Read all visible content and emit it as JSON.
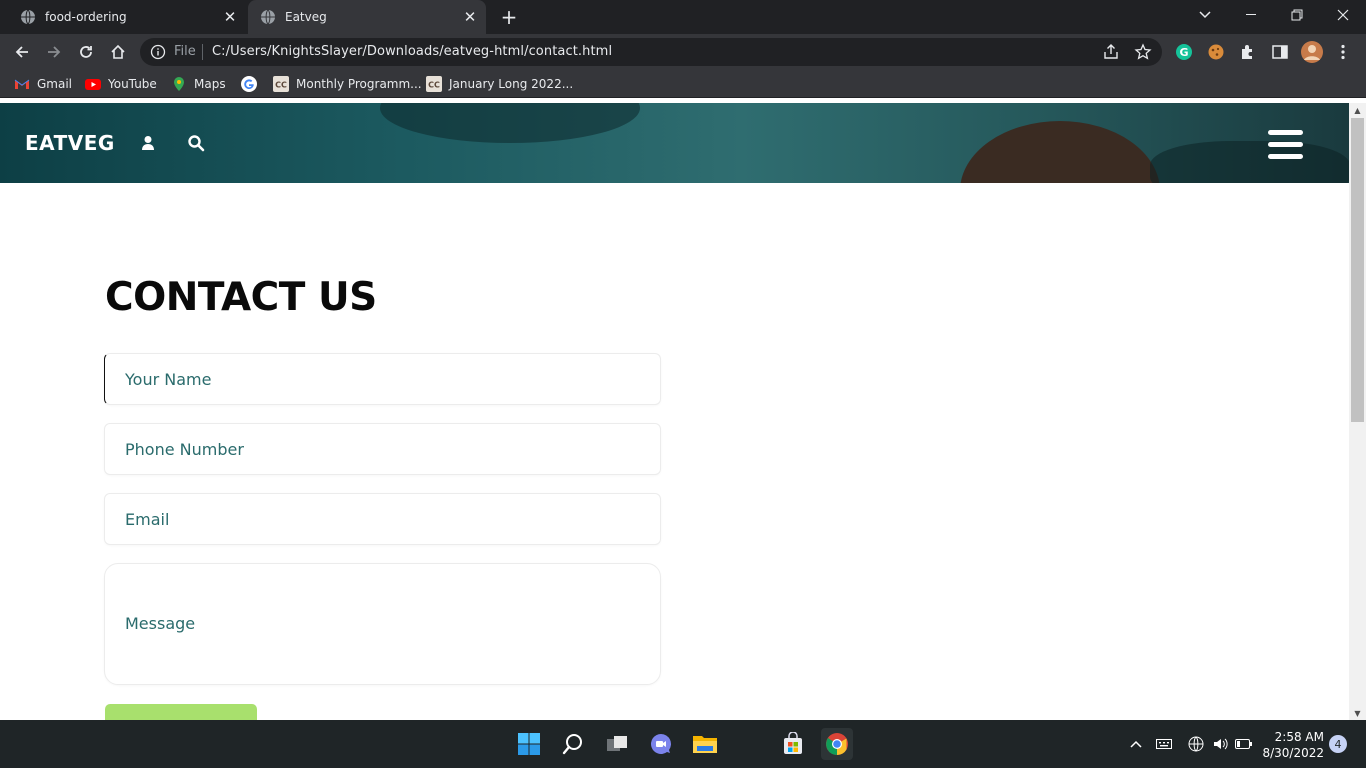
{
  "browser": {
    "tabs": [
      {
        "title": "food-ordering",
        "active": false
      },
      {
        "title": "Eatveg",
        "active": true
      }
    ],
    "address": {
      "scheme_label": "File",
      "url": "C:/Users/KnightsSlayer/Downloads/eatveg-html/contact.html"
    },
    "bookmarks": [
      {
        "label": "Gmail",
        "icon": "gmail-icon"
      },
      {
        "label": "YouTube",
        "icon": "youtube-icon"
      },
      {
        "label": "Maps",
        "icon": "maps-icon"
      },
      {
        "label": "",
        "icon": "google-icon"
      },
      {
        "label": "Monthly Programm...",
        "icon": "codechef-icon"
      },
      {
        "label": "January Long 2022...",
        "icon": "codechef-icon"
      }
    ]
  },
  "site": {
    "brand": "EATVEG",
    "contact": {
      "title": "CONTACT US",
      "name_placeholder": "Your Name",
      "phone_placeholder": "Phone Number",
      "email_placeholder": "Email",
      "message_placeholder": "Message"
    }
  },
  "taskbar": {
    "time": "2:58 AM",
    "date": "8/30/2022",
    "notification_count": "4"
  },
  "colors": {
    "accent_green": "#a8e06d",
    "placeholder_teal": "#2a6b6c",
    "hero_teal": "#1c5a60"
  }
}
